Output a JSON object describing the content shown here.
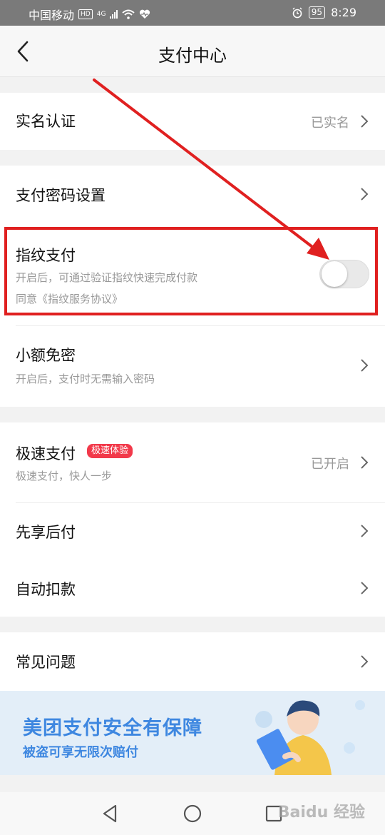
{
  "status_bar": {
    "carrier": "中国移动",
    "hd": "HD",
    "net": "4G",
    "battery": "95",
    "time": "8:29"
  },
  "header": {
    "title": "支付中心"
  },
  "rows": {
    "realname": {
      "title": "实名认证",
      "value": "已实名"
    },
    "password": {
      "title": "支付密码设置"
    },
    "fingerprint": {
      "title": "指纹支付",
      "sub": "开启后，可通过验证指纹快速完成付款",
      "agreement": "同意《指纹服务协议》",
      "enabled": false
    },
    "smallfree": {
      "title": "小额免密",
      "sub": "开启后，支付时无需输入密码"
    },
    "fastpay": {
      "title": "极速支付",
      "badge": "极速体验",
      "sub": "极速支付，快人一步",
      "value": "已开启"
    },
    "paylater": {
      "title": "先享后付"
    },
    "autodebit": {
      "title": "自动扣款"
    },
    "faq": {
      "title": "常见问题"
    }
  },
  "banner": {
    "title": "美团支付安全有保障",
    "subtitle": "被盗可享无限次赔付"
  },
  "watermark": "Baidu 经验",
  "colors": {
    "accent_red": "#e02020",
    "badge_red": "#f2394a",
    "banner_blue": "#3e87e0"
  }
}
